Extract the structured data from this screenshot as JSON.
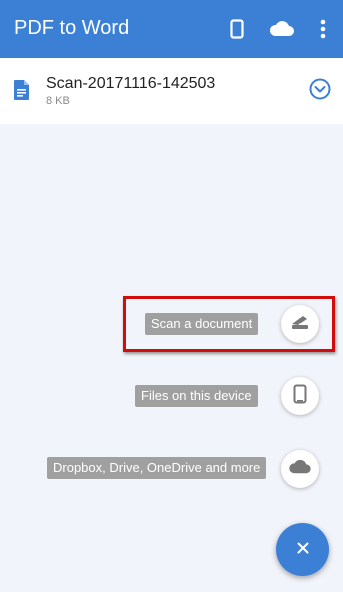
{
  "app_bar": {
    "title": "PDF to Word",
    "icons": [
      "phone-icon",
      "cloud-icon",
      "more-vert-icon"
    ]
  },
  "file": {
    "name": "Scan-20171116-142503",
    "size": "8 KB",
    "icon": "document-icon",
    "expand_icon": "chevron-down-circle-icon"
  },
  "actions": [
    {
      "label": "Scan a document",
      "icon": "scanner-icon",
      "highlighted": true
    },
    {
      "label": "Files on this device",
      "icon": "phone-icon",
      "highlighted": false
    },
    {
      "label": "Dropbox, Drive, OneDrive and more",
      "icon": "cloud-icon",
      "highlighted": false
    }
  ],
  "fab": {
    "icon": "close-icon"
  },
  "colors": {
    "primary": "#3c80d6",
    "background": "#f2f4fb",
    "label_bg": "#a0a0a0",
    "highlight": "#d00c0c"
  }
}
